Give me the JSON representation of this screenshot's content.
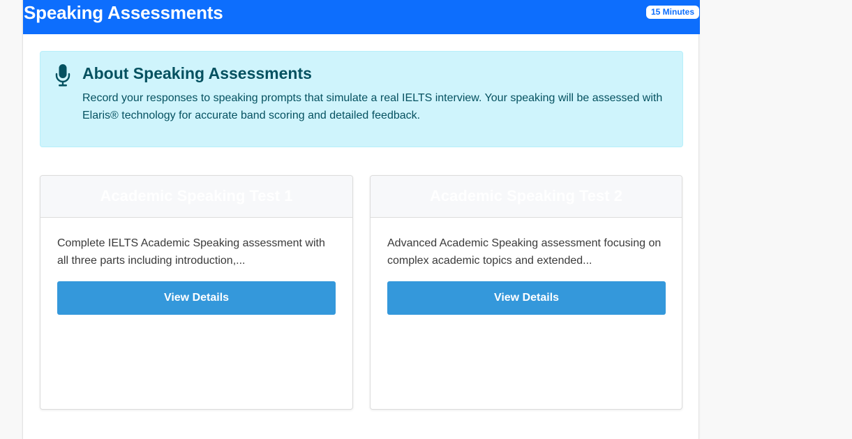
{
  "header": {
    "title": "Speaking Assessments",
    "duration_badge": "15 Minutes",
    "background_color": "#0d6efd"
  },
  "info": {
    "icon": "microphone-icon",
    "title": "About Speaking Assessments",
    "text": "Record your responses to speaking prompts that simulate a real IELTS interview. Your speaking will be assessed with Elaris® technology for accurate band scoring and detailed feedback.",
    "background_color": "#cff4fc",
    "text_color": "#055160"
  },
  "tests": [
    {
      "title": "Academic Speaking Test 1",
      "description": "Complete IELTS Academic Speaking assessment with all three parts including introduction,...",
      "button_label": "View Details"
    },
    {
      "title": "Academic Speaking Test 2",
      "description": "Advanced Academic Speaking assessment focusing on complex academic topics and extended...",
      "button_label": "View Details"
    }
  ],
  "colors": {
    "button": "#3498db",
    "card_header_bg": "#f7f8fa"
  }
}
